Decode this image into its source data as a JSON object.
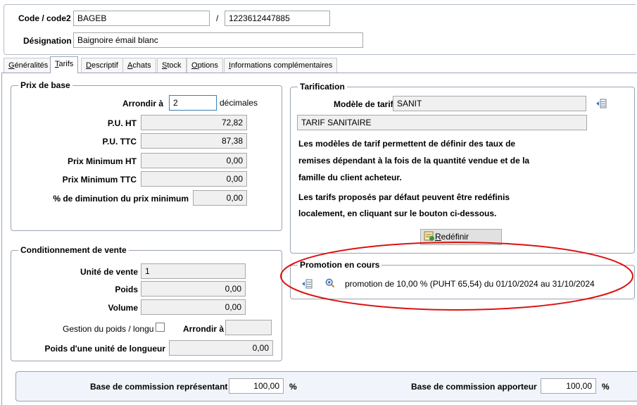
{
  "header": {
    "code_label": "Code / code2",
    "code_value": "BAGEB",
    "separator": "/",
    "code2_value": "1223612447885",
    "designation_label": "Désignation",
    "designation_value": "Baignoire émail blanc"
  },
  "tabs": [
    {
      "label": "Généralités",
      "underline": "G",
      "rest": "énéralités"
    },
    {
      "label": "Tarifs",
      "underline": "T",
      "rest": "arifs"
    },
    {
      "label": "Descriptif",
      "underline": "D",
      "rest": "escriptif"
    },
    {
      "label": "Achats",
      "underline": "A",
      "rest": "chats"
    },
    {
      "label": "Stock",
      "underline": "S",
      "rest": "tock"
    },
    {
      "label": "Options",
      "underline": "O",
      "rest": "ptions"
    },
    {
      "label": "Informations complémentaires",
      "underline": "I",
      "rest": "nformations complémentaires"
    }
  ],
  "prix_de_base": {
    "title": "Prix de base",
    "arrondir_label": "Arrondir à",
    "arrondir_value": "2",
    "decimales_label": "décimales",
    "pu_ht_label": "P.U. HT",
    "pu_ht_value": "72,82",
    "pu_ttc_label": "P.U. TTC",
    "pu_ttc_value": "87,38",
    "prix_min_ht_label": "Prix Minimum HT",
    "prix_min_ht_value": "0,00",
    "prix_min_ttc_label": "Prix Minimum TTC",
    "prix_min_ttc_value": "0,00",
    "diminution_label": "% de diminution du prix minimum",
    "diminution_value": "0,00"
  },
  "conditionnement": {
    "title": "Conditionnement de vente",
    "unite_label": "Unité de vente",
    "unite_value": "1",
    "poids_label": "Poids",
    "poids_value": "0,00",
    "volume_label": "Volume",
    "volume_value": "0,00",
    "gestion_label": "Gestion du poids / longu",
    "arrondir_label": "Arrondir à",
    "arrondir_value": "",
    "poids_unite_label": "Poids d'une unité de longueur",
    "poids_unite_value": "0,00"
  },
  "tarification": {
    "title": "Tarification",
    "modele_label": "Modèle de tarif",
    "modele_value": "SANIT",
    "modele_name": "TARIF SANITAIRE",
    "desc_line1": "Les modèles de tarif permettent de définir des taux de",
    "desc_line2": "remises dépendant à la fois de la quantité vendue et de la",
    "desc_line3": "famille du client acheteur.",
    "desc_line4": "Les tarifs proposés par défaut peuvent être redéfinis",
    "desc_line5": "localement, en cliquant sur le bouton ci-dessous.",
    "redefinir_underline": "R",
    "redefinir_rest": "edéfinir"
  },
  "promotion": {
    "title": "Promotion en cours",
    "text": "promotion de 10,00 % (PUHT 65,54) du 01/10/2024 au 31/10/2024"
  },
  "commission": {
    "representant_label": "Base de commission représentant",
    "representant_value": "100,00",
    "apporteur_label": "Base de commission apporteur",
    "apporteur_value": "100,00",
    "percent": "%"
  },
  "colors": {
    "highlight_circle": "#dd1111",
    "group_border": "#9aa3b3",
    "field_bg": "#f0f0f0",
    "panel_blue": "#f1f5fb"
  }
}
